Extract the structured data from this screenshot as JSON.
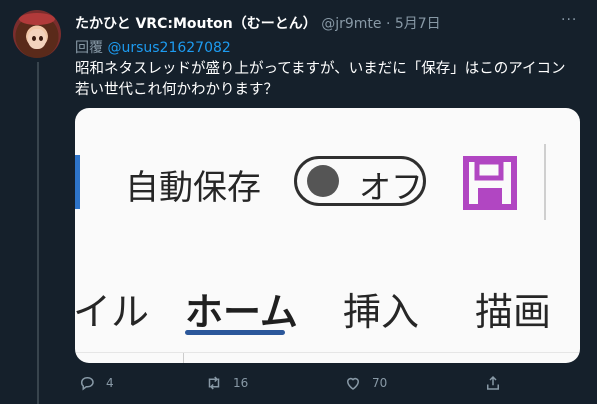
{
  "tweet": {
    "author_name": "たかひと VRC:Mouton（むーとん）",
    "handle": "@jr9mte",
    "separator": "·",
    "date": "5月7日",
    "more": "···",
    "reply_prefix": "回覆",
    "reply_to": "@ursus21627082",
    "text": "昭和ネタスレッドが盛り上がってますが、いまだに「保存」はこのアイコン　若い世代これ何かわかります？"
  },
  "image": {
    "autosave_label": "自動保存",
    "toggle_state": "オフ",
    "tabs": [
      "イル",
      "ホーム",
      "挿入",
      "描画"
    ],
    "active_tab": "ホーム",
    "colors": {
      "save_icon": "#b146c2",
      "tab_underline": "#2b579a"
    }
  },
  "actions": {
    "replies": "4",
    "retweets": "16",
    "likes": "70"
  }
}
